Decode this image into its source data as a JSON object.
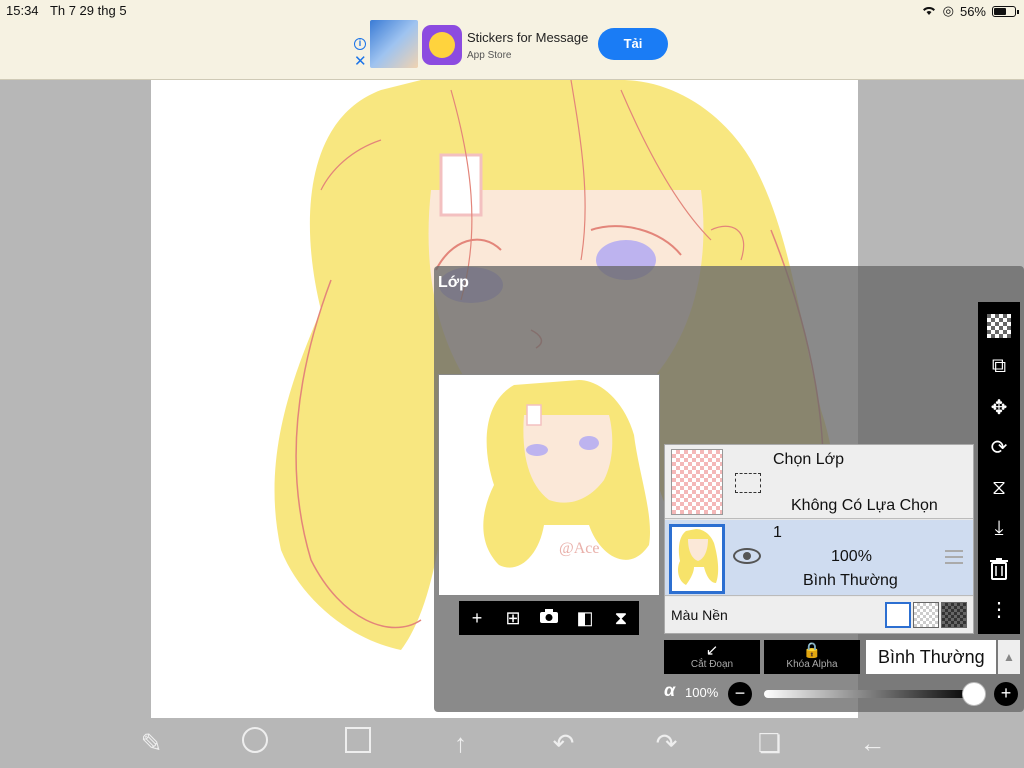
{
  "status": {
    "time": "15:34",
    "date": "Th 7 29 thg 5",
    "battery": "56%"
  },
  "ad": {
    "title": "Stickers for Message",
    "subtitle": "App Store",
    "button": "Tải"
  },
  "layer_panel": {
    "title": "Lớp",
    "selection_layer": {
      "title": "Chọn Lớp",
      "subtitle": "Không Có Lựa Chọn"
    },
    "layer": {
      "name": "1",
      "opacity": "100%",
      "blend": "Bình Thường"
    },
    "background_label": "Màu Nền",
    "clipping_label": "Cắt Đoạn",
    "alpha_lock_label": "Khóa Alpha",
    "blend_mode": "Bình Thường",
    "alpha_symbol": "α",
    "alpha_value": "100%",
    "opacity_fraction": 1.0
  },
  "watermark": "@Ace",
  "icons": [
    "back-arrow-icon",
    "info-icon",
    "close-icon",
    "plus-icon",
    "add-layer-icon",
    "camera-icon",
    "flip-horizontal-icon",
    "flip-vertical-icon",
    "checker-icon",
    "transform-icon",
    "move-icon",
    "rotate-flip-icon",
    "merge-down-icon",
    "trash-icon",
    "more-icon",
    "eye-icon",
    "lock-icon",
    "clip-icon"
  ],
  "colors": {
    "accent": "#2c6fd1",
    "ad_button": "#1a7cf5",
    "hair": "#f7e36a",
    "line": "#e3857a"
  }
}
